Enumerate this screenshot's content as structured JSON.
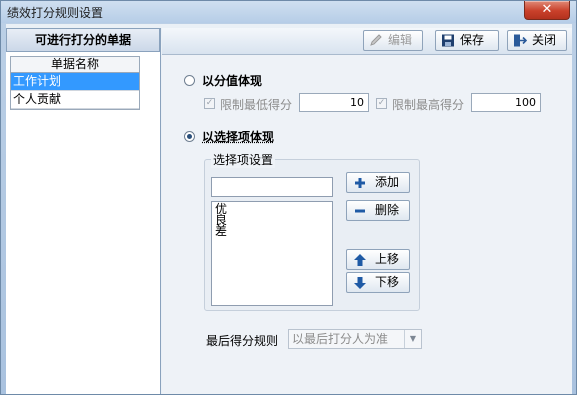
{
  "window": {
    "title": "绩效打分规则设置",
    "close_label": "✕"
  },
  "left": {
    "header": "可进行打分的单据",
    "column_header": "单据名称",
    "items": [
      "工作计划",
      "个人贡献"
    ]
  },
  "toolbar": {
    "edit_label": "编辑",
    "save_label": "保存",
    "close_label": "关闭"
  },
  "score_mode": {
    "label": "以分值体现",
    "min_label": "限制最低得分",
    "min_value": "10",
    "max_label": "限制最高得分",
    "max_value": "100"
  },
  "choice_mode": {
    "label": "以选择项体现",
    "group_title": "选择项设置",
    "input_value": "",
    "options": [
      "优",
      "良",
      "差"
    ],
    "add_label": "添加",
    "delete_label": "删除",
    "up_label": "上移",
    "down_label": "下移"
  },
  "final_rule": {
    "label": "最后得分规则",
    "value": "以最后打分人为准"
  }
}
